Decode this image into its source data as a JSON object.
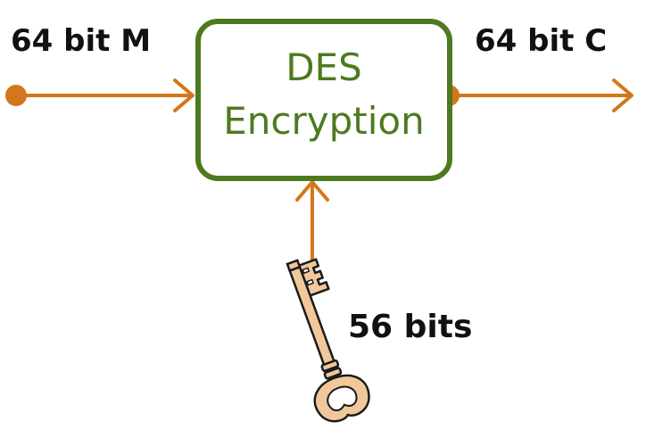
{
  "diagram": {
    "input_label": "64 bit M",
    "output_label": "64 bit C",
    "box_line1": "DES",
    "box_line2": "Encryption",
    "key_label": "56 bits"
  },
  "colors": {
    "arrow": "#d4761c",
    "box_border": "#4d7a1f",
    "box_text": "#4d7a1f",
    "label_text": "#111111",
    "key_fill": "#f0c899",
    "key_outline": "#1a1a1a"
  },
  "icons": {
    "key": "key-icon"
  }
}
